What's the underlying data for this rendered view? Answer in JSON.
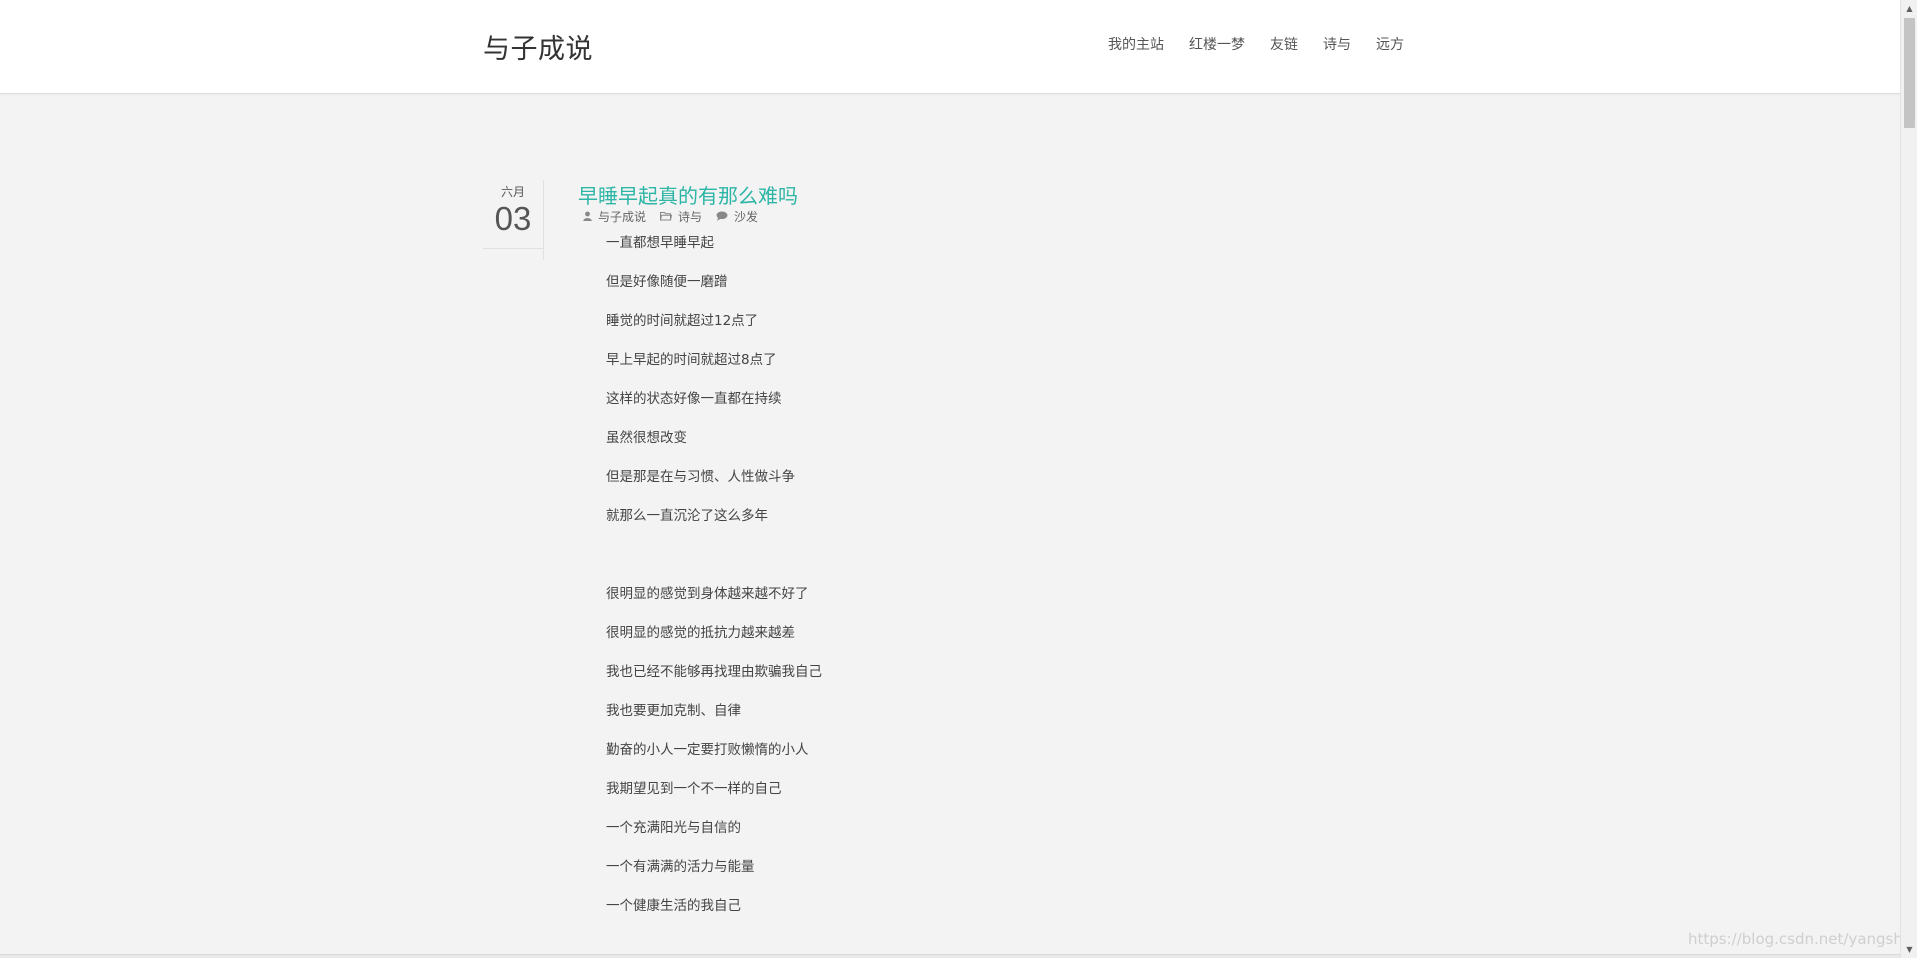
{
  "header": {
    "site_title": "与子成说",
    "nav": [
      "我的主站",
      "红楼一梦",
      "友链",
      "诗与",
      "远方"
    ]
  },
  "post": {
    "date_month": "六月",
    "date_day": "03",
    "title": "早睡早起真的有那么难吗",
    "meta": {
      "author": "与子成说",
      "category": "诗与",
      "comments": "沙发"
    },
    "lines": [
      "一直都想早睡早起",
      "但是好像随便一磨蹭",
      "睡觉的时间就超过12点了",
      "早上早起的时间就超过8点了",
      "这样的状态好像一直都在持续",
      "虽然很想改变",
      "但是那是在与习惯、人性做斗争",
      "就那么一直沉沦了这么多年",
      "",
      "很明显的感觉到身体越来越不好了",
      "很明显的感觉的抵抗力越来越差",
      "我也已经不能够再找理由欺骗我自己",
      "我也要更加克制、自律",
      "勤奋的小人一定要打败懒惰的小人",
      "我期望见到一个不一样的自己",
      "一个充满阳光与自信的",
      "一个有满满的活力与能量",
      "一个健康生活的我自己"
    ]
  },
  "watermark": "https://blog.csdn.net/yangshang",
  "icons": {
    "author": "user-icon",
    "category": "folder-icon",
    "comments": "comment-icon"
  },
  "colors": {
    "title_accent": "#2db5a6",
    "background": "#f3f3f3",
    "header_bg": "#ffffff"
  }
}
